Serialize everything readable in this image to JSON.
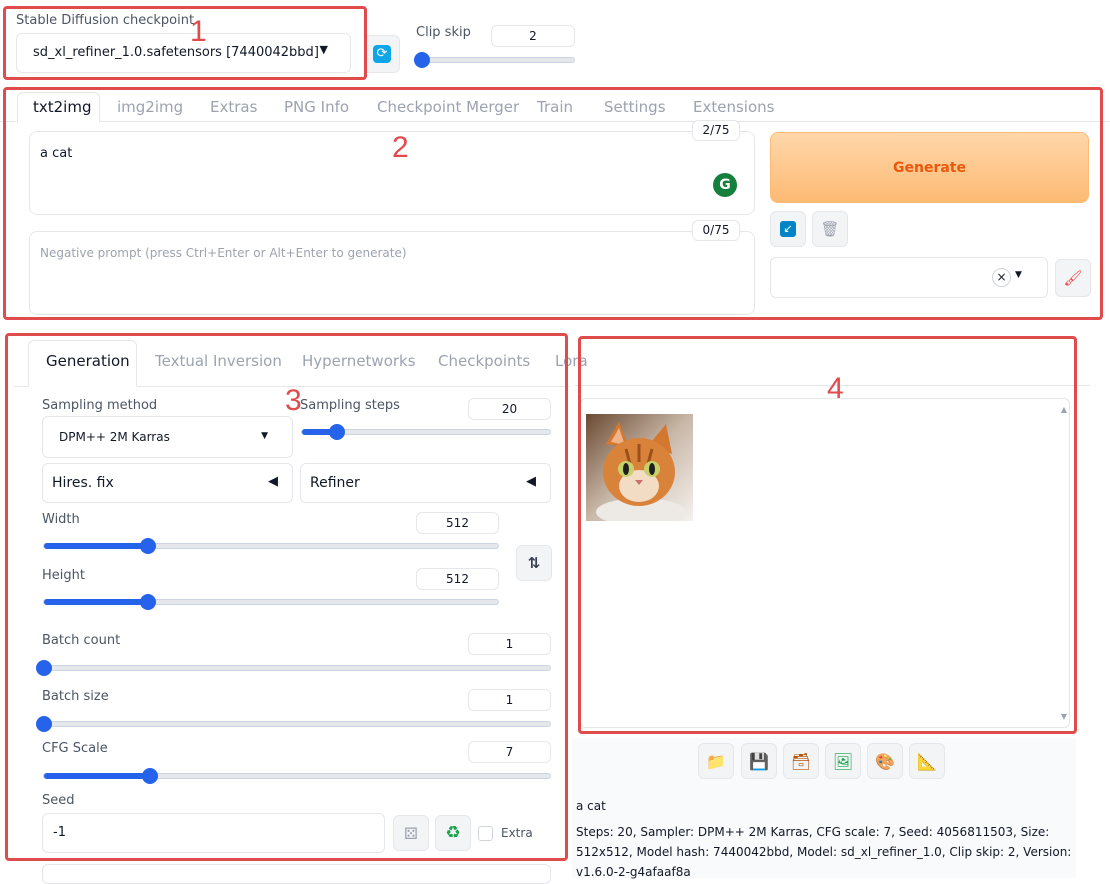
{
  "checkpoint": {
    "label": "Stable Diffusion checkpoint",
    "value": "sd_xl_refiner_1.0.safetensors [7440042bbd]"
  },
  "clip_skip": {
    "label": "Clip skip",
    "value": "2",
    "fraction": 0.0
  },
  "main_tabs": [
    "txt2img",
    "img2img",
    "Extras",
    "PNG Info",
    "Checkpoint Merger",
    "Train",
    "Settings",
    "Extensions"
  ],
  "prompt": {
    "value": "a cat",
    "counter": "2/75"
  },
  "negative_prompt": {
    "placeholder": "Negative prompt (press Ctrl+Enter or Alt+Enter to generate)",
    "counter": "0/75"
  },
  "generate_label": "Generate",
  "style_clear": "×",
  "sub_tabs": [
    "Generation",
    "Textual Inversion",
    "Hypernetworks",
    "Checkpoints",
    "Lora"
  ],
  "sampling_method": {
    "label": "Sampling method",
    "value": "DPM++ 2M Karras"
  },
  "sampling_steps": {
    "label": "Sampling steps",
    "value": "20",
    "fraction": 0.14
  },
  "hires_fix": "Hires. fix",
  "refiner": "Refiner",
  "width": {
    "label": "Width",
    "value": "512",
    "fraction": 0.23
  },
  "height": {
    "label": "Height",
    "value": "512",
    "fraction": 0.23
  },
  "batch_count": {
    "label": "Batch count",
    "value": "1",
    "fraction": 0.0
  },
  "batch_size": {
    "label": "Batch size",
    "value": "1",
    "fraction": 0.0
  },
  "cfg_scale": {
    "label": "CFG Scale",
    "value": "7",
    "fraction": 0.21
  },
  "seed": {
    "label": "Seed",
    "value": "-1"
  },
  "extra_label": "Extra",
  "output": {
    "caption": "a cat",
    "info": "Steps: 20, Sampler: DPM++ 2M Karras, CFG scale: 7, Seed: 4056811503, Size: 512x512, Model hash: 7440042bbd, Model: sd_xl_refiner_1.0, Clip skip: 2, Version: v1.6.0-2-g4afaaf8a"
  },
  "annotations": [
    "1",
    "2",
    "3",
    "4"
  ],
  "colors": {
    "accent": "#2563eb",
    "generate_text": "#ea580c",
    "annotation": "#e04b4b"
  }
}
